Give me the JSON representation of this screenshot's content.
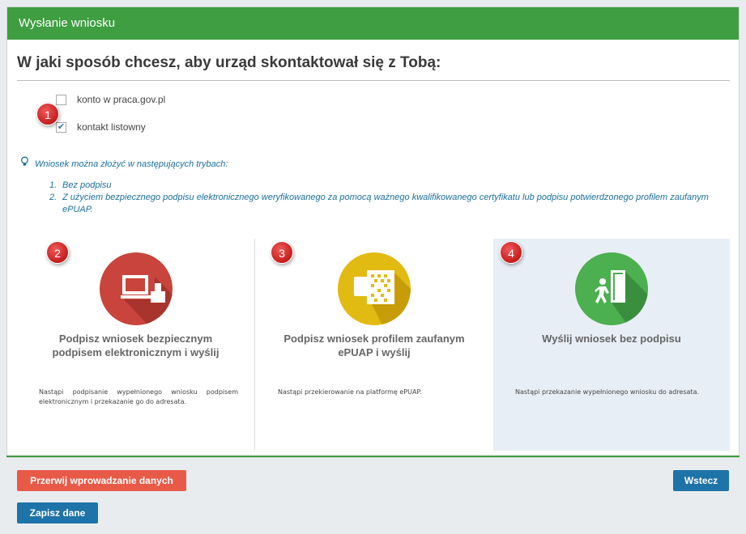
{
  "panel": {
    "title": "Wysłanie wniosku"
  },
  "question": "W jaki sposób chcesz, aby urząd skontaktował się z Tobą:",
  "contact_options": [
    {
      "label": "konto w praca.gov.pl",
      "checked": false
    },
    {
      "label": "kontakt listowny",
      "checked": true
    }
  ],
  "badges": [
    "1",
    "2",
    "3",
    "4"
  ],
  "info": {
    "icon": "lightbulb-icon",
    "text": "Wniosek można złożyć w następujących trybach:",
    "modes": [
      {
        "num": "1.",
        "text": "Bez podpisu"
      },
      {
        "num": "2.",
        "text": "Z użyciem bezpiecznego podpisu elektronicznego weryfikowanego za pomocą ważnego kwalifikowanego certyfikatu lub podpisu potwierdzonego profilem zaufanym ePUAP."
      }
    ]
  },
  "options": [
    {
      "title": "Podpisz wniosek bezpiecznym podpisem elektronicznym i wyślij",
      "desc": "Nastąpi podpisanie wypełnionego wniosku podpisem elektronicznym i przekazanie go do adresata.",
      "icon": "computer-signature-icon",
      "color": "#c8443c"
    },
    {
      "title": "Podpisz wniosek profilem zaufanym ePUAP i wyślij",
      "desc": "Nastąpi przekierowanie na platformę ePUAP.",
      "icon": "epuap-qr-icon",
      "color": "#e2bb12"
    },
    {
      "title": "Wyślij wniosek bez podpisu",
      "desc": "Nastąpi przekazanie wypełnionego wniosku do adresata.",
      "icon": "person-exit-icon",
      "color": "#4caf50"
    }
  ],
  "buttons": {
    "cancel": "Przerwij wprowadzanie danych",
    "back": "Wstecz",
    "save": "Zapisz dane"
  }
}
